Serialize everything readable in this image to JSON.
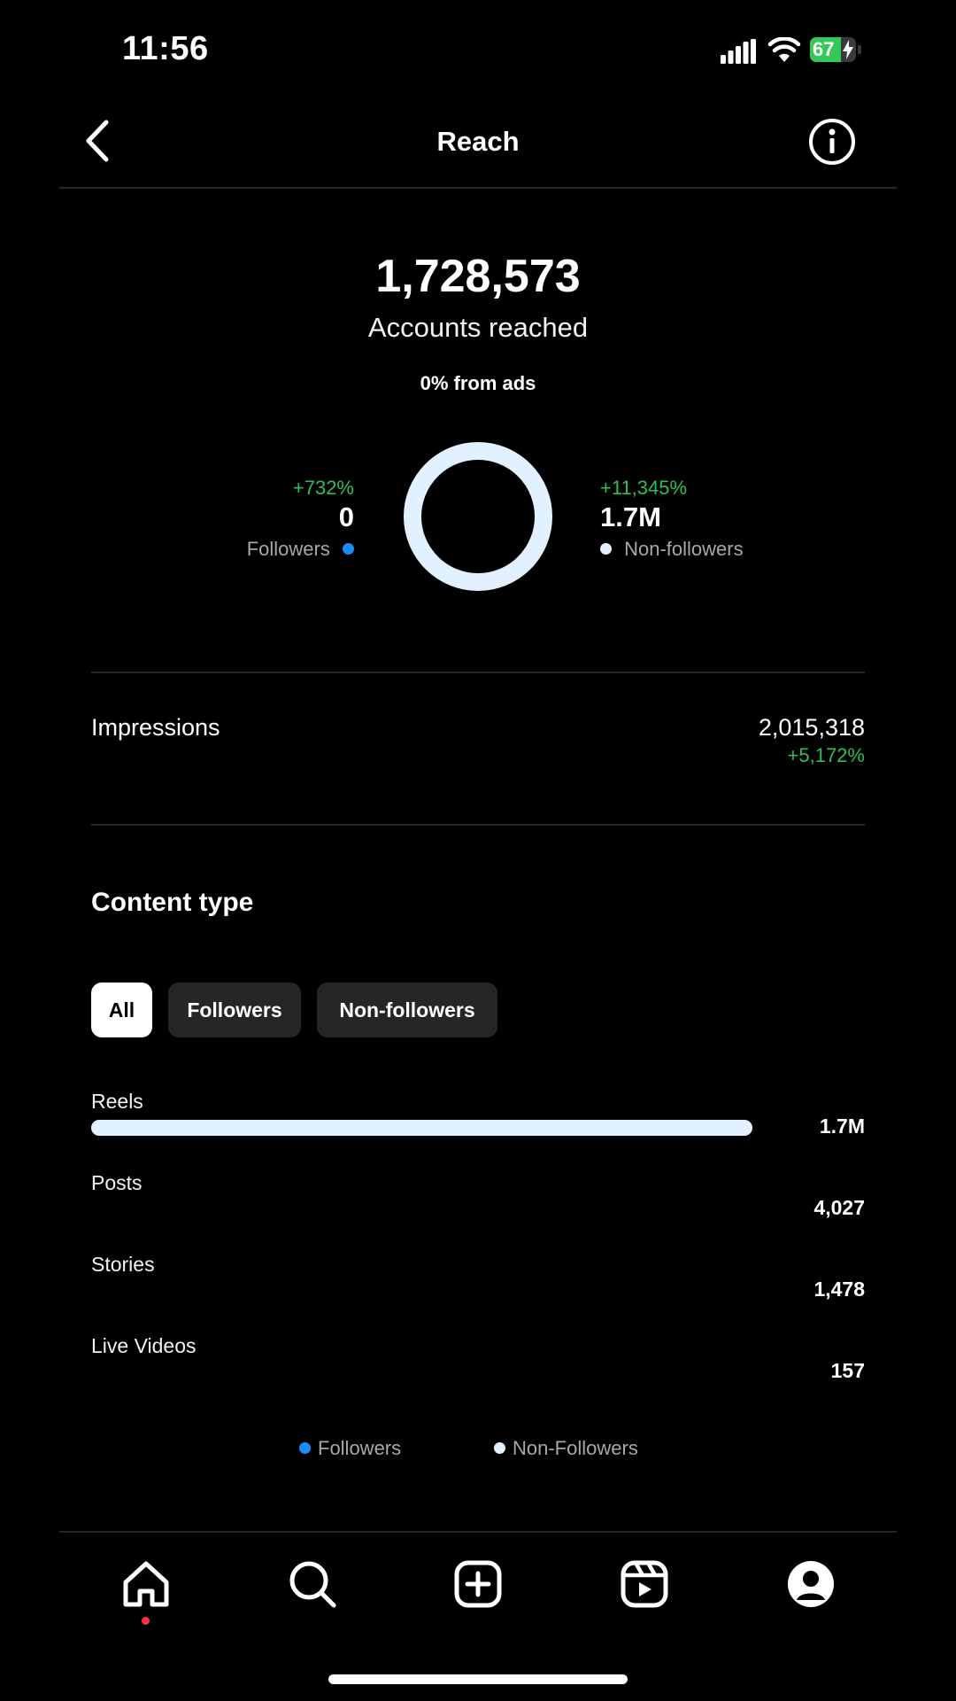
{
  "status_bar": {
    "time": "11:56",
    "battery_level": "67",
    "battery_percent": 67
  },
  "header": {
    "title": "Reach",
    "back_icon": "chevron-left-icon",
    "info_icon": "info-icon"
  },
  "summary": {
    "accounts_reached": "1,728,573",
    "accounts_reached_label": "Accounts reached",
    "from_ads": "0% from ads"
  },
  "split": {
    "followers": {
      "change": "+732%",
      "value": "0",
      "label": "Followers",
      "color": "#1a8cff"
    },
    "non_followers": {
      "change": "+11,345%",
      "value": "1.7M",
      "label": "Non-followers",
      "color": "#e2f1ff"
    }
  },
  "impressions": {
    "label": "Impressions",
    "value": "2,015,318",
    "change": "+5,172%"
  },
  "content_type": {
    "title": "Content type",
    "filters": [
      {
        "label": "All",
        "selected": true
      },
      {
        "label": "Followers",
        "selected": false
      },
      {
        "label": "Non-followers",
        "selected": false
      }
    ],
    "rows": [
      {
        "label": "Reels",
        "value": "1.7M",
        "fraction": 1.0
      },
      {
        "label": "Posts",
        "value": "4,027",
        "fraction": 0.0
      },
      {
        "label": "Stories",
        "value": "1,478",
        "fraction": 0.0
      },
      {
        "label": "Live Videos",
        "value": "157",
        "fraction": 0.0
      }
    ],
    "legend": [
      {
        "label": "Followers",
        "color": "#1a8cff"
      },
      {
        "label": "Non-Followers",
        "color": "#e2f1ff"
      }
    ]
  },
  "colors": {
    "positive": "#2ebd59",
    "accent_followers": "#1a8cff",
    "accent_non_followers": "#e2f1ff",
    "notification_dot": "#ff3040"
  },
  "bottom_nav": [
    {
      "icon": "home-icon",
      "active": true
    },
    {
      "icon": "search-icon",
      "active": false
    },
    {
      "icon": "create-icon",
      "active": false
    },
    {
      "icon": "reels-icon",
      "active": false
    },
    {
      "icon": "profile-icon",
      "active": false
    }
  ]
}
